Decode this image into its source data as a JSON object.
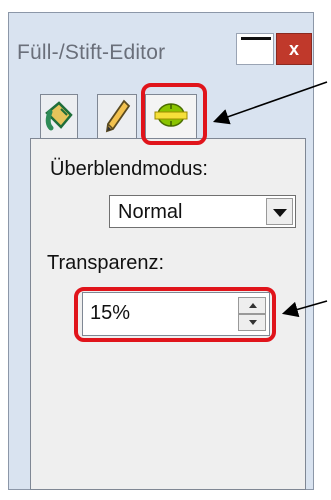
{
  "window": {
    "title": "Füll-/Stift-Editor",
    "close_symbol": "x",
    "minimize_icon": "minimize-icon",
    "close_icon": "close-icon"
  },
  "tabs": [
    {
      "icon": "paint-bucket-icon",
      "accent": "#2e8b57"
    },
    {
      "icon": "pencil-icon",
      "accent": "#c79a2a"
    },
    {
      "icon": "transparency-icon",
      "accent": "#8ac400"
    }
  ],
  "blend_mode": {
    "label": "Überblendmodus:",
    "selected": "Normal"
  },
  "transparency": {
    "label": "Transparenz:",
    "value": "15%"
  },
  "colors": {
    "highlight": "#e0141b",
    "close_button": "#c0392b"
  }
}
